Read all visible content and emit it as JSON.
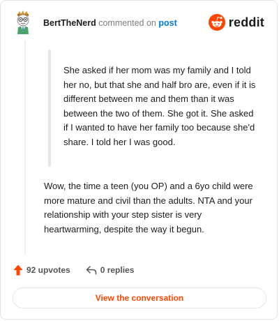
{
  "comment": {
    "username": "BertTheNerd",
    "action_text": "commented on",
    "post_link": "post",
    "quoted_text": "She asked if her mom was my family and I told her no, but that she and half bro are, even if it is different between me and them than it was between the two of them. She got it. She asked if I wanted to have her family too because she'd share. I told her I was good.",
    "body_text": "Wow, the time a teen (you OP) and a 6yo child were more mature and civil than the adults. NTA and your relationship with your step sister is very heartwarming, despite the way it begun."
  },
  "brand": {
    "name": "reddit",
    "icon": "reddit-logo-icon",
    "color": "#ff4500"
  },
  "actions": {
    "upvotes": "92 upvotes",
    "upvote_icon": "upvote-arrow-icon",
    "replies": "0 replies",
    "reply_icon": "reply-arrow-icon"
  },
  "cta": {
    "label": "View the conversation"
  },
  "colors": {
    "accent": "#ff4500",
    "link": "#0079d3",
    "muted": "#7c7c7c"
  }
}
